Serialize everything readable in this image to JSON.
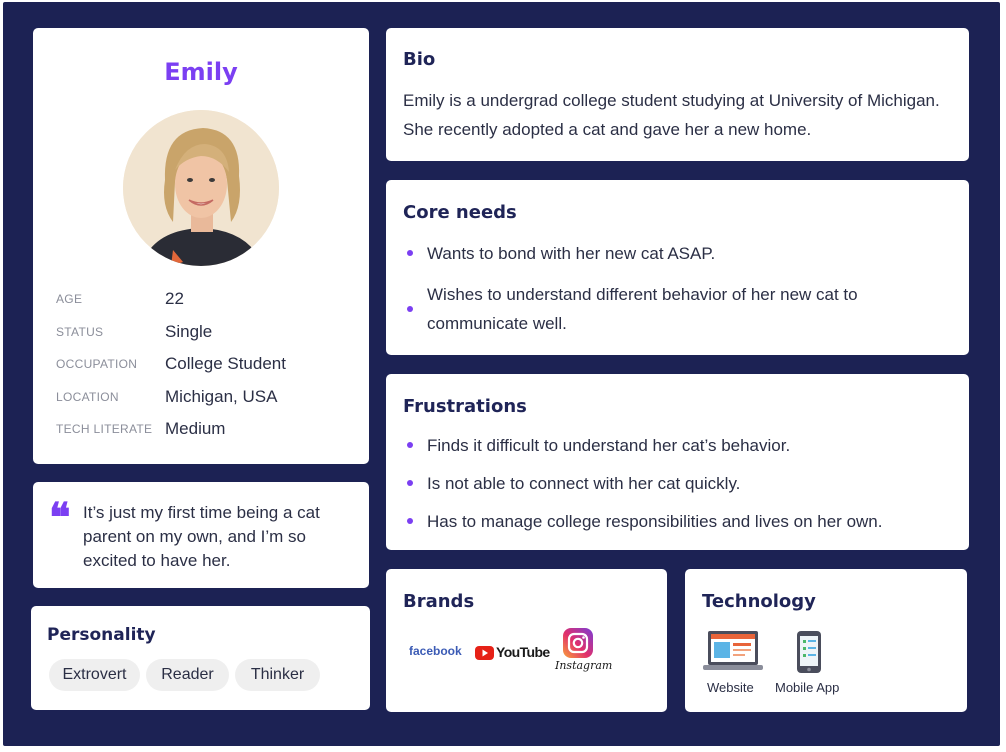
{
  "profile": {
    "name": "Emily",
    "details": [
      {
        "label": "AGE",
        "value": "22"
      },
      {
        "label": "STATUS",
        "value": "Single"
      },
      {
        "label": "OCCUPATION",
        "value": "College Student"
      },
      {
        "label": "LOCATION",
        "value": "Michigan, USA"
      },
      {
        "label": "TECH LITERATE",
        "value": "Medium"
      }
    ]
  },
  "quote": {
    "mark": "❝",
    "text": "It’s just my first time being a cat parent on my own, and I’m so excited to have her."
  },
  "personality": {
    "title": "Personality",
    "traits": [
      "Extrovert",
      "Reader",
      "Thinker"
    ]
  },
  "bio": {
    "title": "Bio",
    "text": "Emily is a undergrad college student studying at University of Michigan. She recently adopted a cat and gave her a new home."
  },
  "core_needs": {
    "title": "Core needs",
    "items": [
      "Wants to bond with her new cat ASAP.",
      "Wishes to understand different behavior of her new cat to communicate well."
    ]
  },
  "frustrations": {
    "title": "Frustrations",
    "items": [
      "Finds it difficult to understand her cat’s behavior.",
      "Is not able to connect with her cat quickly.",
      "Has to manage college responsibilities and lives on her own."
    ]
  },
  "brands": {
    "title": "Brands",
    "logos": {
      "facebook": "facebook",
      "youtube": "YouTube",
      "instagram": "Instagram"
    }
  },
  "technology": {
    "title": "Technology",
    "items": [
      "Website",
      "Mobile App"
    ]
  },
  "colors": {
    "background": "#1c2254",
    "accent": "#7b3ff2",
    "heading": "#1f2457",
    "chip": "#efefef"
  }
}
